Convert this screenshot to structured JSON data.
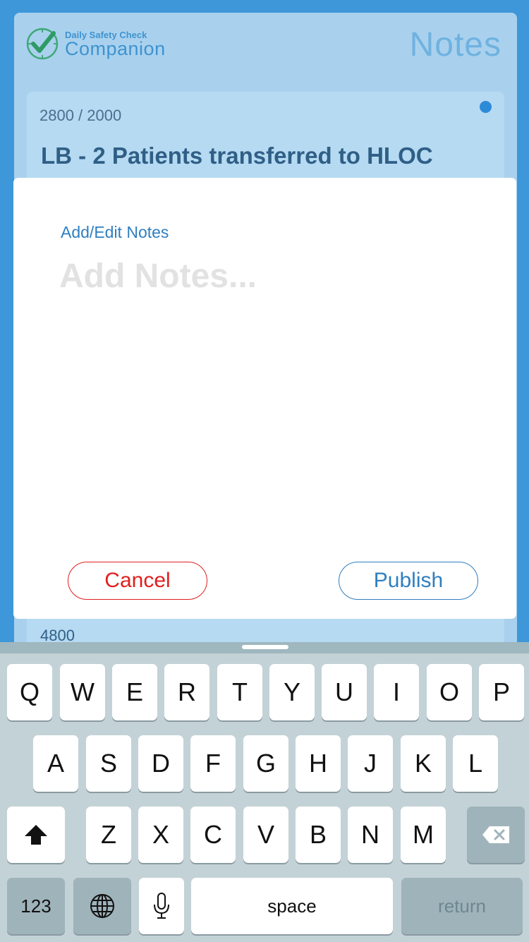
{
  "app": {
    "brand_small": "Daily Safety Check",
    "brand_large": "Companion",
    "page_title": "Notes"
  },
  "card": {
    "count": "2800 / 2000",
    "title": "LB - 2 Patients transferred to HLOC"
  },
  "next_card": {
    "count": "4800"
  },
  "modal": {
    "label": "Add/Edit Notes",
    "placeholder": "Add Notes...",
    "cancel_label": "Cancel",
    "publish_label": "Publish"
  },
  "keyboard": {
    "row1": [
      "Q",
      "W",
      "E",
      "R",
      "T",
      "Y",
      "U",
      "I",
      "O",
      "P"
    ],
    "row2": [
      "A",
      "S",
      "D",
      "F",
      "G",
      "H",
      "J",
      "K",
      "L"
    ],
    "row3": [
      "Z",
      "X",
      "C",
      "V",
      "B",
      "N",
      "M"
    ],
    "numbers_label": "123",
    "space_label": "space",
    "return_label": "return"
  },
  "colors": {
    "accent": "#2f7fc0",
    "danger": "#e0201f",
    "logo_green": "#3fa878"
  }
}
